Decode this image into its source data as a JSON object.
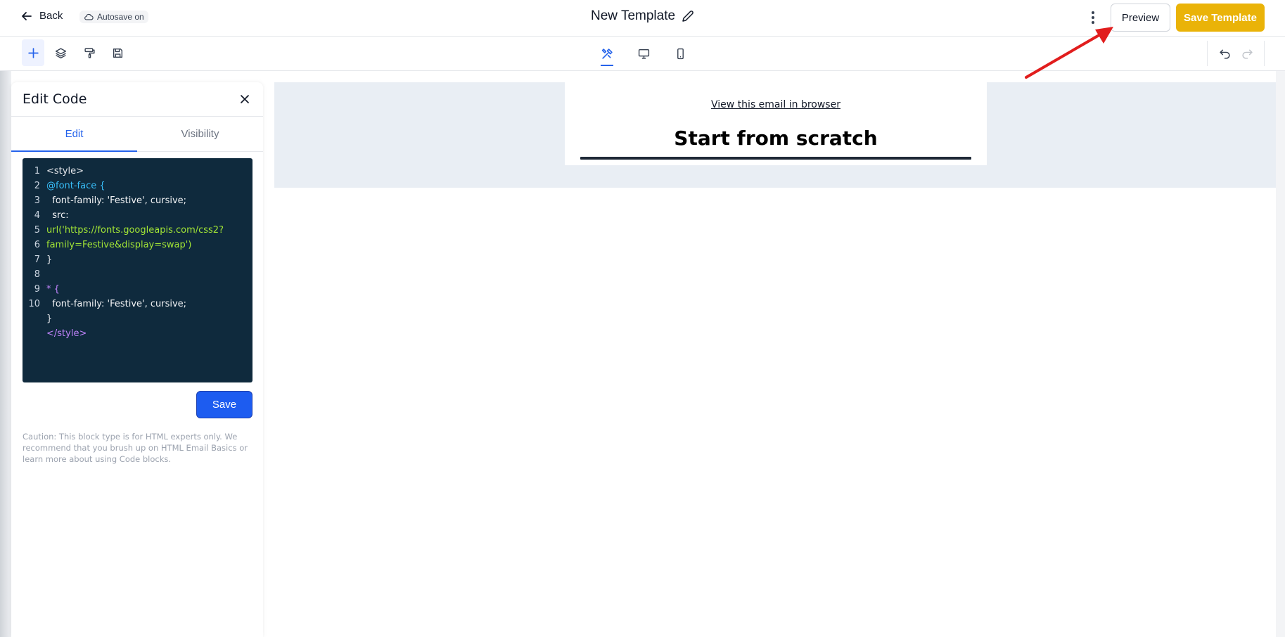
{
  "header": {
    "back_label": "Back",
    "autosave_label": "Autosave on",
    "title": "New Template",
    "preview_label": "Preview",
    "save_template_label": "Save Template",
    "save_template_color": "#eab308"
  },
  "toolbar": {
    "tools": [
      "plus-icon",
      "layers-icon",
      "paint-roller-icon",
      "save-disk-icon"
    ],
    "views": [
      "tools-icon",
      "desktop-icon",
      "mobile-icon"
    ],
    "active_view": "tools-icon",
    "history": [
      "undo-icon",
      "redo-icon"
    ]
  },
  "panel": {
    "title": "Edit Code",
    "tabs": [
      {
        "label": "Edit",
        "active": true
      },
      {
        "label": "Visibility",
        "active": false
      }
    ],
    "code_lines": [
      "<style>",
      "@font-face {",
      "  font-family: 'Festive', cursive;",
      "  src:",
      "url('https://fonts.googleapis.com/css2?",
      "family=Festive&display=swap')",
      "}",
      "",
      "* {",
      "  font-family: 'Festive', cursive;",
      "}",
      "</style>"
    ],
    "line_numbers": [
      "1",
      "2",
      "3",
      "4",
      "5",
      "6",
      "7",
      "8",
      "9",
      "10",
      "",
      ""
    ],
    "save_label": "Save",
    "caution_text": "Caution: This block type is for HTML experts only. We recommend that you brush up on HTML Email Basics or learn more about using Code blocks."
  },
  "canvas": {
    "view_link": "View this email in browser",
    "heading": "Start from scratch",
    "background_color": "#e9eef4"
  }
}
